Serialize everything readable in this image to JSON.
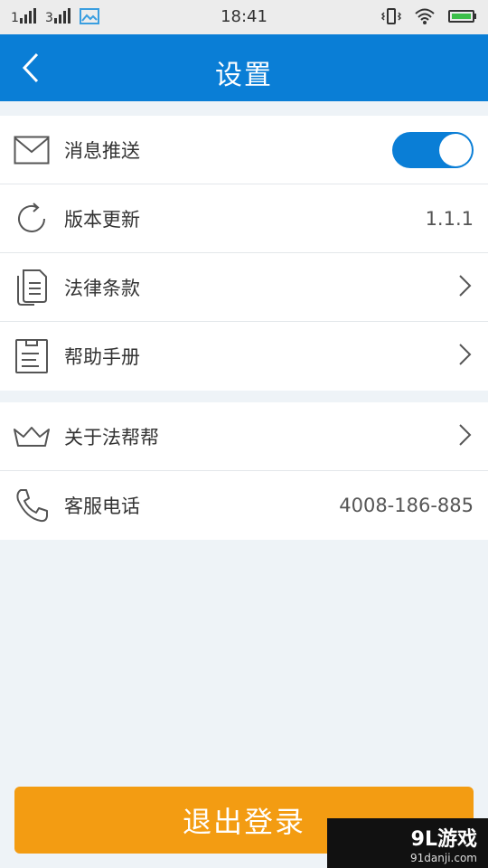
{
  "status_bar": {
    "time": "18:41"
  },
  "header": {
    "title": "设置"
  },
  "settings": {
    "group1": [
      {
        "label": "消息推送",
        "icon": "envelope-icon",
        "control": "toggle",
        "enabled": true
      },
      {
        "label": "版本更新",
        "icon": "refresh-icon",
        "value": "1.1.1"
      },
      {
        "label": "法律条款",
        "icon": "documents-icon"
      },
      {
        "label": "帮助手册",
        "icon": "manual-icon"
      }
    ],
    "group2": [
      {
        "label": "关于法帮帮",
        "icon": "crown-icon"
      },
      {
        "label": "客服电话",
        "icon": "phone-icon",
        "value": "4008-186-885"
      }
    ]
  },
  "logout": {
    "label": "退出登录"
  },
  "watermark": {
    "main": "9L游戏",
    "sub": "91danji.com"
  },
  "colors": {
    "header": "#0a7ed6",
    "accent_orange": "#f39c12",
    "phone_text": "#f2b13b"
  }
}
